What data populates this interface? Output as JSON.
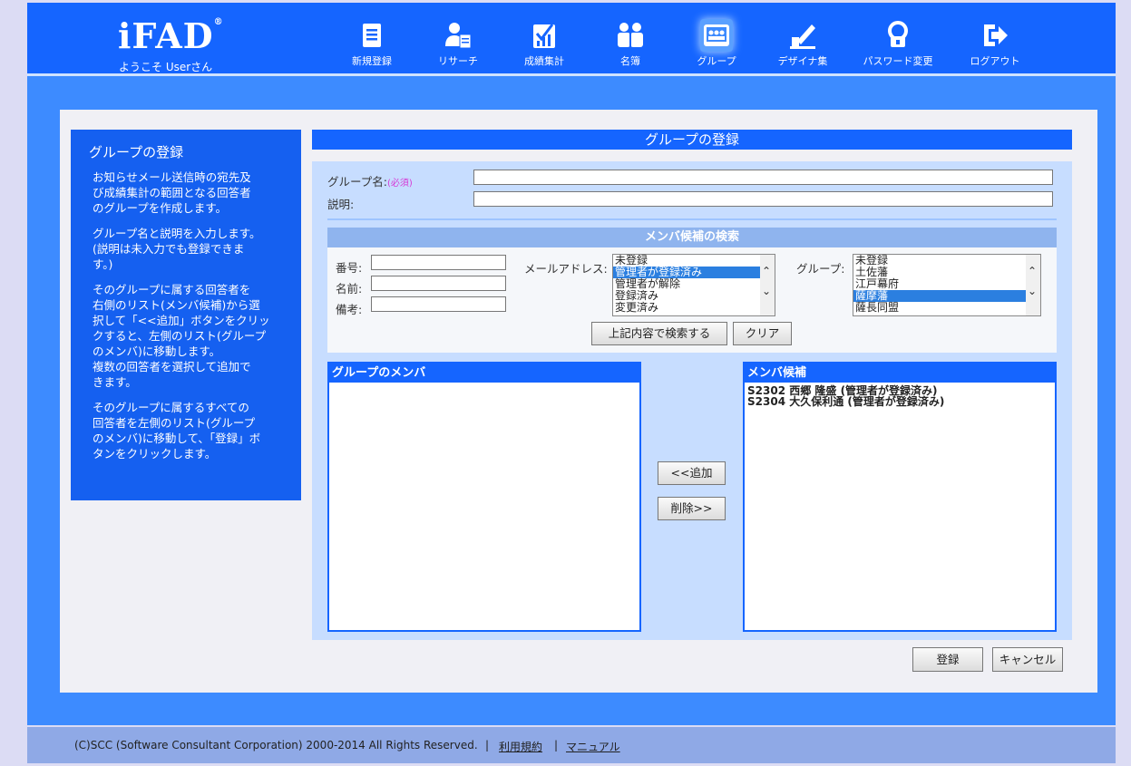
{
  "header": {
    "logo": "iFAD",
    "logo_mark": "®",
    "welcome": "ようこそ Userさん",
    "nav": [
      {
        "label": "新規登録",
        "icon": "document-new-icon"
      },
      {
        "label": "リサーチ",
        "icon": "research-icon"
      },
      {
        "label": "成績集計",
        "icon": "chart-check-icon"
      },
      {
        "label": "名簿",
        "icon": "people-icon"
      },
      {
        "label": "グループ",
        "icon": "group-icon",
        "active": true
      },
      {
        "label": "デザイナ集",
        "icon": "pencil-design-icon"
      },
      {
        "label": "パスワード変更",
        "icon": "key-lock-icon"
      },
      {
        "label": "ログアウト",
        "icon": "logout-arrow-icon"
      }
    ]
  },
  "help": {
    "title": "グループの登録",
    "paragraphs": [
      "お知らせメール送信時の宛先及\nび成績集計の範囲となる回答者\nのグループを作成します。",
      "グループ名と説明を入力します。\n(説明は未入力でも登録できま\nす。)",
      "そのグループに属する回答者を\n右側のリスト(メンバ候補)から選\n択して「<<追加」ボタンをクリッ\nクすると、左側のリスト(グループ\nのメンバ)に移動します。\n複数の回答者を選択して追加で\nきます。",
      "そのグループに属するすべての\n回答者を左側のリスト(グループ\nのメンバ)に移動して、「登録」ボ\nタンをクリックします。"
    ]
  },
  "form": {
    "title": "グループの登録",
    "group_name_label": "グループ名:",
    "required_mark": "(必須)",
    "group_name_value": "",
    "description_label": "説明:",
    "description_value": ""
  },
  "search": {
    "title": "メンバ候補の検索",
    "number_label": "番号:",
    "name_label": "名前:",
    "note_label": "備考:",
    "mail_label": "メールアドレス:",
    "mail_options": [
      "未登録",
      "管理者が登録済み",
      "管理者が解除",
      "登録済み",
      "変更済み"
    ],
    "mail_selected_index": 1,
    "group_label": "グループ:",
    "group_options": [
      "未登録",
      "土佐藩",
      "江戸幕府",
      "薩摩藩",
      "薩長同盟"
    ],
    "group_selected_index": 3,
    "search_button": "上記内容で検索する",
    "clear_button": "クリア"
  },
  "members": {
    "title": "グループのメンバ",
    "items": []
  },
  "candidates": {
    "title": "メンバ候補",
    "items": [
      "S2302 西郷 隆盛 (管理者が登録済み)",
      "S2304 大久保利通 (管理者が登録済み)"
    ]
  },
  "buttons": {
    "add": "<<追加",
    "remove": "削除>>",
    "register": "登録",
    "cancel": "キャンセル"
  },
  "footer": {
    "copyright": "(C)SCC (Software Consultant Corporation) 2000-2014 All Rights Reserved.",
    "separator": "|",
    "terms": "利用規約",
    "manual": "マニュアル"
  },
  "colors": {
    "header_blue": "#1565ff",
    "area_blue": "#3d8bff",
    "selection_blue": "#2b7fe0",
    "required_pink": "#d63ad6"
  }
}
